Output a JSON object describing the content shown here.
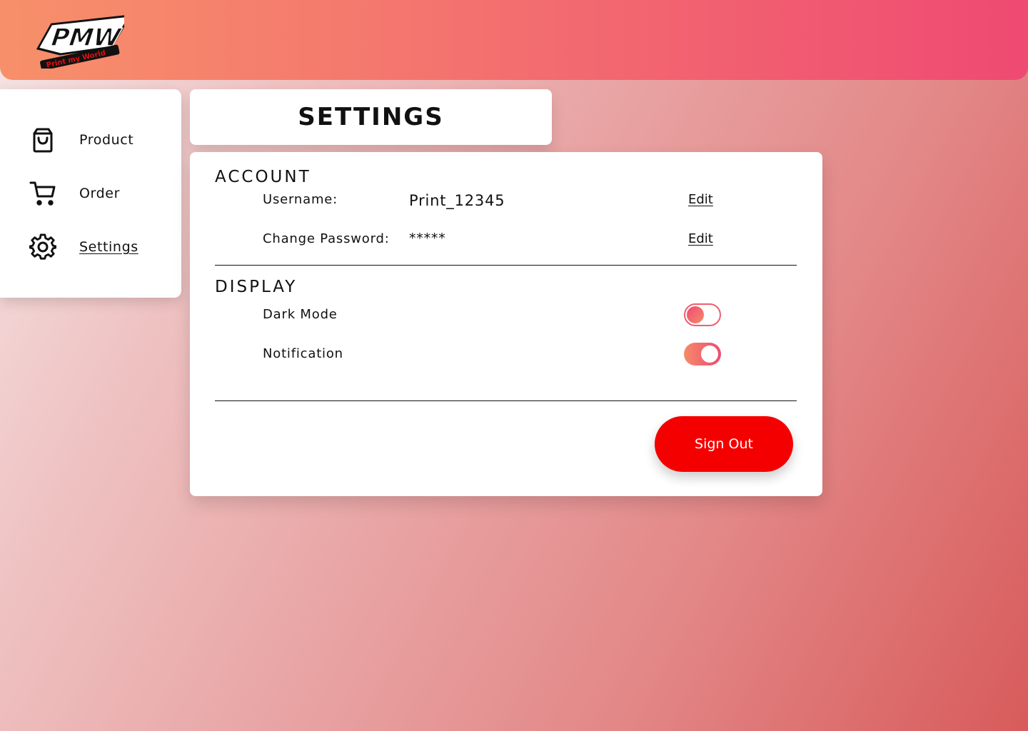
{
  "header": {
    "logo": {
      "icon": "pmw-logo",
      "text": "PMW",
      "tagline": "Print my World"
    }
  },
  "sidebar": {
    "items": [
      {
        "label": "Product",
        "icon": "shopping-bag-icon"
      },
      {
        "label": "Order",
        "icon": "cart-icon"
      },
      {
        "label": "Settings",
        "icon": "gear-icon",
        "active": true
      }
    ]
  },
  "page": {
    "title": "SETTINGS"
  },
  "account": {
    "heading": "ACCOUNT",
    "username_label": "Username:",
    "username_value": "Print_12345",
    "password_label": "Change Password:",
    "password_value": "*****",
    "edit_label": "Edit"
  },
  "display": {
    "heading": "DISPLAY",
    "dark_mode_label": "Dark Mode",
    "dark_mode_on": false,
    "notification_label": "Notification",
    "notification_on": true
  },
  "actions": {
    "sign_out_label": "Sign Out"
  },
  "colors": {
    "header_start": "#f7906a",
    "header_end": "#ef4a72",
    "sign_out": "#f50000"
  }
}
